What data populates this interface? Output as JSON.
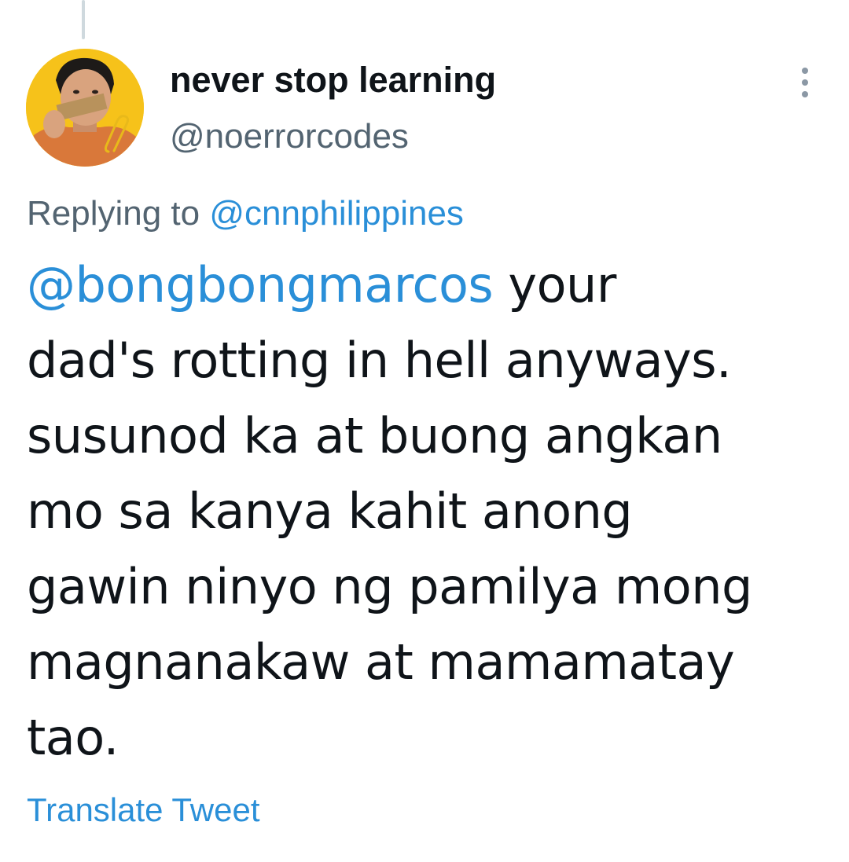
{
  "author": {
    "display_name": "never stop learning",
    "handle": "@noerrorcodes",
    "avatar_bg_color": "#f6c21a"
  },
  "more_menu_icon": "more-vertical-icon",
  "reply_context": {
    "prefix": "Replying to",
    "mention": "@cnnphilippines"
  },
  "tweet": {
    "mention": "@bongbongmarcos",
    "line1_rest": " your",
    "lines": [
      "dad's rotting in hell anyways.",
      "susunod ka at buong angkan",
      "mo sa kanya kahit anong",
      "gawin ninyo ng pamilya mong",
      "magnanakaw at mamamatay",
      "tao."
    ]
  },
  "translate_label": "Translate Tweet",
  "colors": {
    "link": "#2a8fd8",
    "text": "#0f1419",
    "secondary": "#536471"
  }
}
